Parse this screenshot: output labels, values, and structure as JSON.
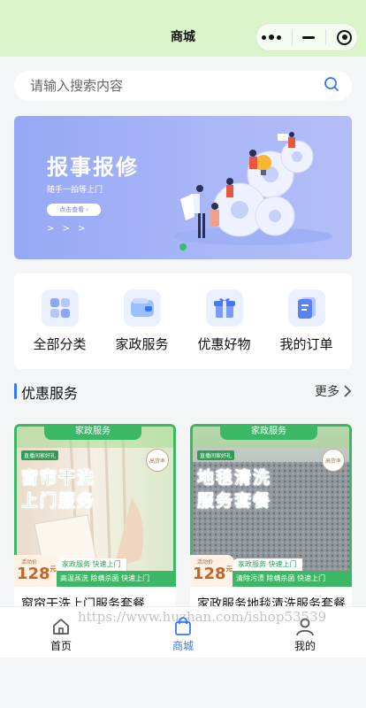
{
  "navbar": {
    "title": "商城",
    "capsule_icons": [
      "more-dots-icon",
      "minimize-icon",
      "close-target-icon"
    ]
  },
  "search": {
    "placeholder": "请输入搜索内容",
    "icon": "search-icon",
    "accent": "#3478f6"
  },
  "banner": {
    "title": "报事报修",
    "subtitle": "随手一拍等上门",
    "button_label": "点击查看",
    "arrows": "> > >",
    "colors": {
      "background": "#96a8f5",
      "indicator": "#2ec26b"
    }
  },
  "categories": [
    {
      "label": "全部分类",
      "icon": "grid-icon"
    },
    {
      "label": "家政服务",
      "icon": "wallet-icon"
    },
    {
      "label": "优惠好物",
      "icon": "gift-icon"
    },
    {
      "label": "我的订单",
      "icon": "order-icon"
    }
  ],
  "section": {
    "title": "优惠服务",
    "more_label": "更多"
  },
  "products": [
    {
      "tag": "家政服务",
      "mini_tag": "直播间家好礼",
      "headline_1": "窗帘干洗",
      "headline_2": "上门服务",
      "stamp": "高货率",
      "price_label": "活动价",
      "price": "128",
      "price_unit": "元",
      "service_tags": "家政服务  快速上门",
      "features": "高温蒸洗  除螨杀菌  快速上门",
      "name": "窗帘干洗上门服务套餐"
    },
    {
      "tag": "家政服务",
      "mini_tag": "直播间家好礼",
      "headline_1": "地毯清洗",
      "headline_2": "服务套餐",
      "stamp": "高货率",
      "price_label": "活动价",
      "price": "128",
      "price_unit": "元",
      "service_tags": "家政服务  快速上门",
      "features": "清除污渍  除螨杀菌  快速上门",
      "name": "家政服务地毯清洗服务套餐"
    }
  ],
  "tabbar": {
    "items": [
      {
        "label": "首页",
        "icon": "home-icon",
        "active": false
      },
      {
        "label": "商城",
        "icon": "bag-icon",
        "active": true
      },
      {
        "label": "我的",
        "icon": "person-icon",
        "active": false
      }
    ],
    "active_color": "#3478f6"
  },
  "watermark": "https://www.huzhan.com/ishop53539"
}
